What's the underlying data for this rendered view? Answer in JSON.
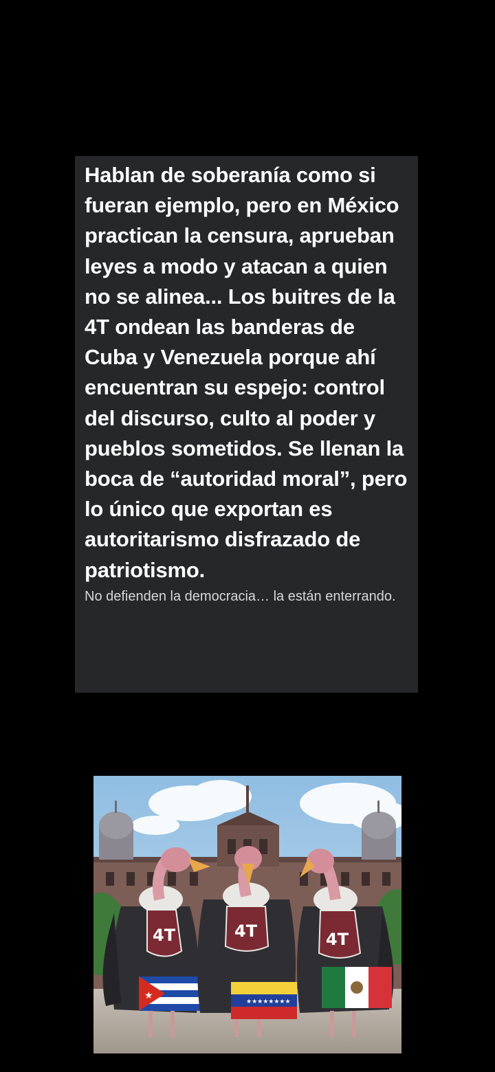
{
  "post": {
    "body": "Hablan de soberanía como si fueran ejemplo, pero en México practican la censura, aprueban leyes a modo y atacan a quien no se alinea... Los buitres de la 4T ondean las banderas de Cuba y Venezuela porque ahí encuentran su espejo: control del discurso, culto al poder y pueblos sometidos. Se llenan la boca de “autoridad moral”, pero lo único que exportan es autoritarismo disfrazado de patriotismo.",
    "caption": "No defienden la democracia… la están enterrando."
  },
  "image": {
    "badges": [
      "4T",
      "4T",
      "4T"
    ],
    "flags": [
      "cuba-flag",
      "venezuela-flag",
      "mexico-flag"
    ],
    "colors": {
      "sky": "#9cc4e4",
      "palace": "#7a5c55",
      "badge": "#7b2a34",
      "ground": "#b9b1a8"
    }
  }
}
